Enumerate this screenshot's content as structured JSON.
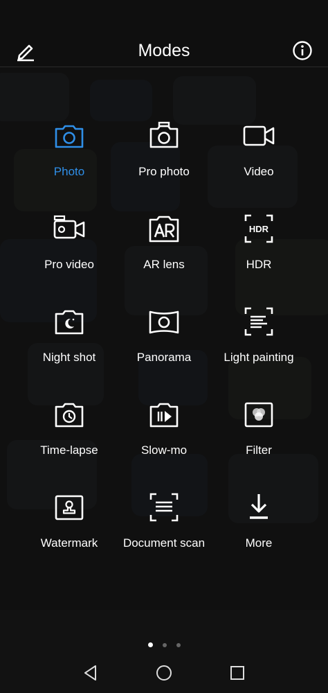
{
  "header": {
    "title": "Modes"
  },
  "accent_color": "#2f8fe8",
  "modes": [
    {
      "label": "Photo",
      "icon": "camera-icon",
      "active": true
    },
    {
      "label": "Pro photo",
      "icon": "pro-camera-icon",
      "active": false
    },
    {
      "label": "Video",
      "icon": "video-camera-icon",
      "active": false
    },
    {
      "label": "Pro video",
      "icon": "pro-video-icon",
      "active": false
    },
    {
      "label": "AR lens",
      "icon": "ar-lens-icon",
      "active": false
    },
    {
      "label": "HDR",
      "icon": "hdr-icon",
      "active": false
    },
    {
      "label": "Night shot",
      "icon": "night-shot-icon",
      "active": false
    },
    {
      "label": "Panorama",
      "icon": "panorama-icon",
      "active": false
    },
    {
      "label": "Light painting",
      "icon": "light-painting-icon",
      "active": false
    },
    {
      "label": "Time-lapse",
      "icon": "time-lapse-icon",
      "active": false
    },
    {
      "label": "Slow-mo",
      "icon": "slow-mo-icon",
      "active": false
    },
    {
      "label": "Filter",
      "icon": "filter-icon",
      "active": false
    },
    {
      "label": "Watermark",
      "icon": "watermark-icon",
      "active": false
    },
    {
      "label": "Document scan",
      "icon": "document-scan-icon",
      "active": false
    },
    {
      "label": "More",
      "icon": "download-icon",
      "active": false
    }
  ],
  "page_indicator": {
    "pages": 3,
    "current": 1
  }
}
